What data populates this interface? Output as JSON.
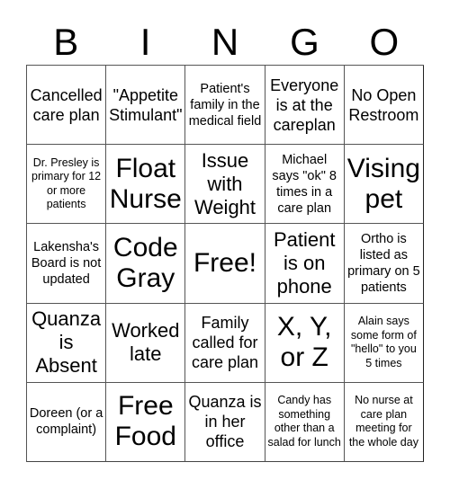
{
  "header": {
    "letters": [
      "B",
      "I",
      "N",
      "G",
      "O"
    ]
  },
  "cells": [
    "Cancelled care plan",
    "\"Appetite Stimulant\"",
    "Patient's family in the medical field",
    "Everyone is at the careplan",
    "No Open Restroom",
    "Dr. Presley is primary for 12 or more patients",
    "Float Nurse",
    "Issue with Weight",
    "Michael says \"ok\" 8 times in a care plan",
    "Vising pet",
    "Lakensha's Board is not updated",
    "Code Gray",
    "Free!",
    "Patient is on phone",
    "Ortho is listed as primary on 5 patients",
    "Quanza is Absent",
    "Worked late",
    "Family called for care plan",
    "X, Y, or Z",
    "Alain says some form of \"hello\" to you 5 times",
    "Doreen (or a complaint)",
    "Free Food",
    "Quanza is in her office",
    "Candy has something other than a salad for lunch",
    "No nurse at care plan meeting for the whole day"
  ]
}
